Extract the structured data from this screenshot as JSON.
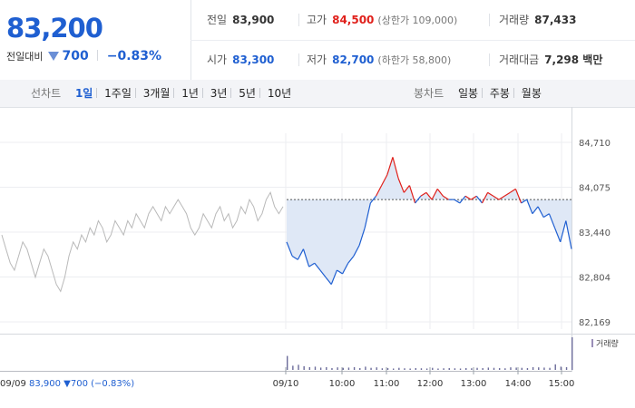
{
  "current": {
    "price": "83,200",
    "change_label": "전일대비",
    "change_value": "700",
    "change_pct": "−0.83%"
  },
  "stats": {
    "prev_label": "전일",
    "prev_value": "83,900",
    "high_label": "고가",
    "high_value": "84,500",
    "upper_limit": "(상한가 109,000)",
    "volume_label": "거래량",
    "volume_value": "87,433",
    "open_label": "시가",
    "open_value": "83,300",
    "low_label": "저가",
    "low_value": "82,700",
    "lower_limit": "(하한가 58,800)",
    "amount_label": "거래대금",
    "amount_value": "7,298 백만"
  },
  "toolbar": {
    "line_label": "선차트",
    "line_periods": [
      "1일",
      "1주일",
      "3개월",
      "1년",
      "3년",
      "5년",
      "10년"
    ],
    "selected_period": "1일",
    "candle_label": "봉차트",
    "candle_periods": [
      "일봉",
      "주봉",
      "월봉"
    ]
  },
  "footer": {
    "prev_date": "09/09",
    "prev_close": "83,900",
    "prev_change": "700",
    "prev_pct": "(−0.83%)"
  },
  "colors": {
    "up": "#e0201b",
    "down": "#1f5fd1",
    "prev_day": "#b9b9b9",
    "fill_down": "#dfe8f6",
    "fill_up": "#fbe3e3"
  },
  "chart_data": {
    "type": "line",
    "baseline": 83900,
    "ylim": [
      82169,
      84710
    ],
    "yticks": [
      84710,
      84075,
      83440,
      82804,
      82169
    ],
    "ytick_labels": [
      "84,710",
      "84,075",
      "83,440",
      "82,804",
      "82,169"
    ],
    "xticks": [
      "09/10",
      "10:00",
      "11:00",
      "12:00",
      "13:00",
      "14:00",
      "15:00"
    ],
    "volume_label": "거래량",
    "series": [
      {
        "values": [
          83400,
          83200,
          83000,
          82900,
          83100,
          83300,
          83200,
          83000,
          82800,
          83000,
          83200,
          83100,
          82900,
          82700,
          82600,
          82800,
          83100,
          83300,
          83200,
          83400,
          83300,
          83500,
          83400,
          83600,
          83500,
          83300,
          83400,
          83600,
          83500,
          83400,
          83600,
          83500,
          83700,
          83600,
          83500,
          83700,
          83800,
          83700,
          83600,
          83800,
          83700,
          83800,
          83900,
          83800,
          83700,
          83500,
          83400,
          83500,
          83700,
          83600,
          83500,
          83700,
          83800,
          83600,
          83700,
          83500,
          83600,
          83800,
          83700,
          83900,
          83800,
          83600,
          83700,
          83900,
          84000,
          83800,
          83700,
          83800
        ]
      },
      {
        "x": [
          "09:00",
          "09:05",
          "09:10",
          "09:15",
          "09:20",
          "09:25",
          "09:30",
          "09:35",
          "09:40",
          "09:45",
          "09:50",
          "09:55",
          "10:00",
          "10:05",
          "10:10",
          "10:15",
          "10:20",
          "10:25",
          "10:30",
          "10:35",
          "10:40",
          "10:45",
          "10:50",
          "10:55",
          "11:00",
          "11:10",
          "11:20",
          "11:30",
          "11:40",
          "11:50",
          "12:00",
          "12:10",
          "12:20",
          "12:30",
          "12:40",
          "12:50",
          "13:00",
          "13:10",
          "13:20",
          "13:30",
          "13:40",
          "13:50",
          "14:00",
          "14:10",
          "14:20",
          "14:30",
          "14:40",
          "14:50",
          "15:00",
          "15:10",
          "15:20",
          "15:30"
        ],
        "values": [
          83300,
          83100,
          83050,
          83200,
          82950,
          83000,
          82900,
          82800,
          82700,
          82900,
          82850,
          83000,
          83100,
          83250,
          83500,
          83850,
          83950,
          84100,
          84250,
          84500,
          84200,
          84000,
          84100,
          83850,
          83950,
          84000,
          83900,
          84050,
          83950,
          83900,
          83900,
          83850,
          83950,
          83900,
          83950,
          83850,
          84000,
          83950,
          83900,
          83950,
          84000,
          84050,
          83850,
          83900,
          83700,
          83800,
          83650,
          83700,
          83500,
          83300,
          83600,
          83200
        ]
      }
    ],
    "volume": [
      300,
      90,
      110,
      80,
      60,
      70,
      50,
      60,
      40,
      55,
      45,
      50,
      60,
      40,
      70,
      45,
      55,
      35,
      40,
      30,
      45,
      35,
      30,
      40,
      35,
      30,
      45,
      30,
      35,
      40,
      35,
      30,
      40,
      35,
      45,
      40,
      50,
      45,
      40,
      35,
      55,
      50,
      45,
      40,
      60,
      55,
      50,
      45,
      120,
      70,
      60,
      700
    ]
  }
}
